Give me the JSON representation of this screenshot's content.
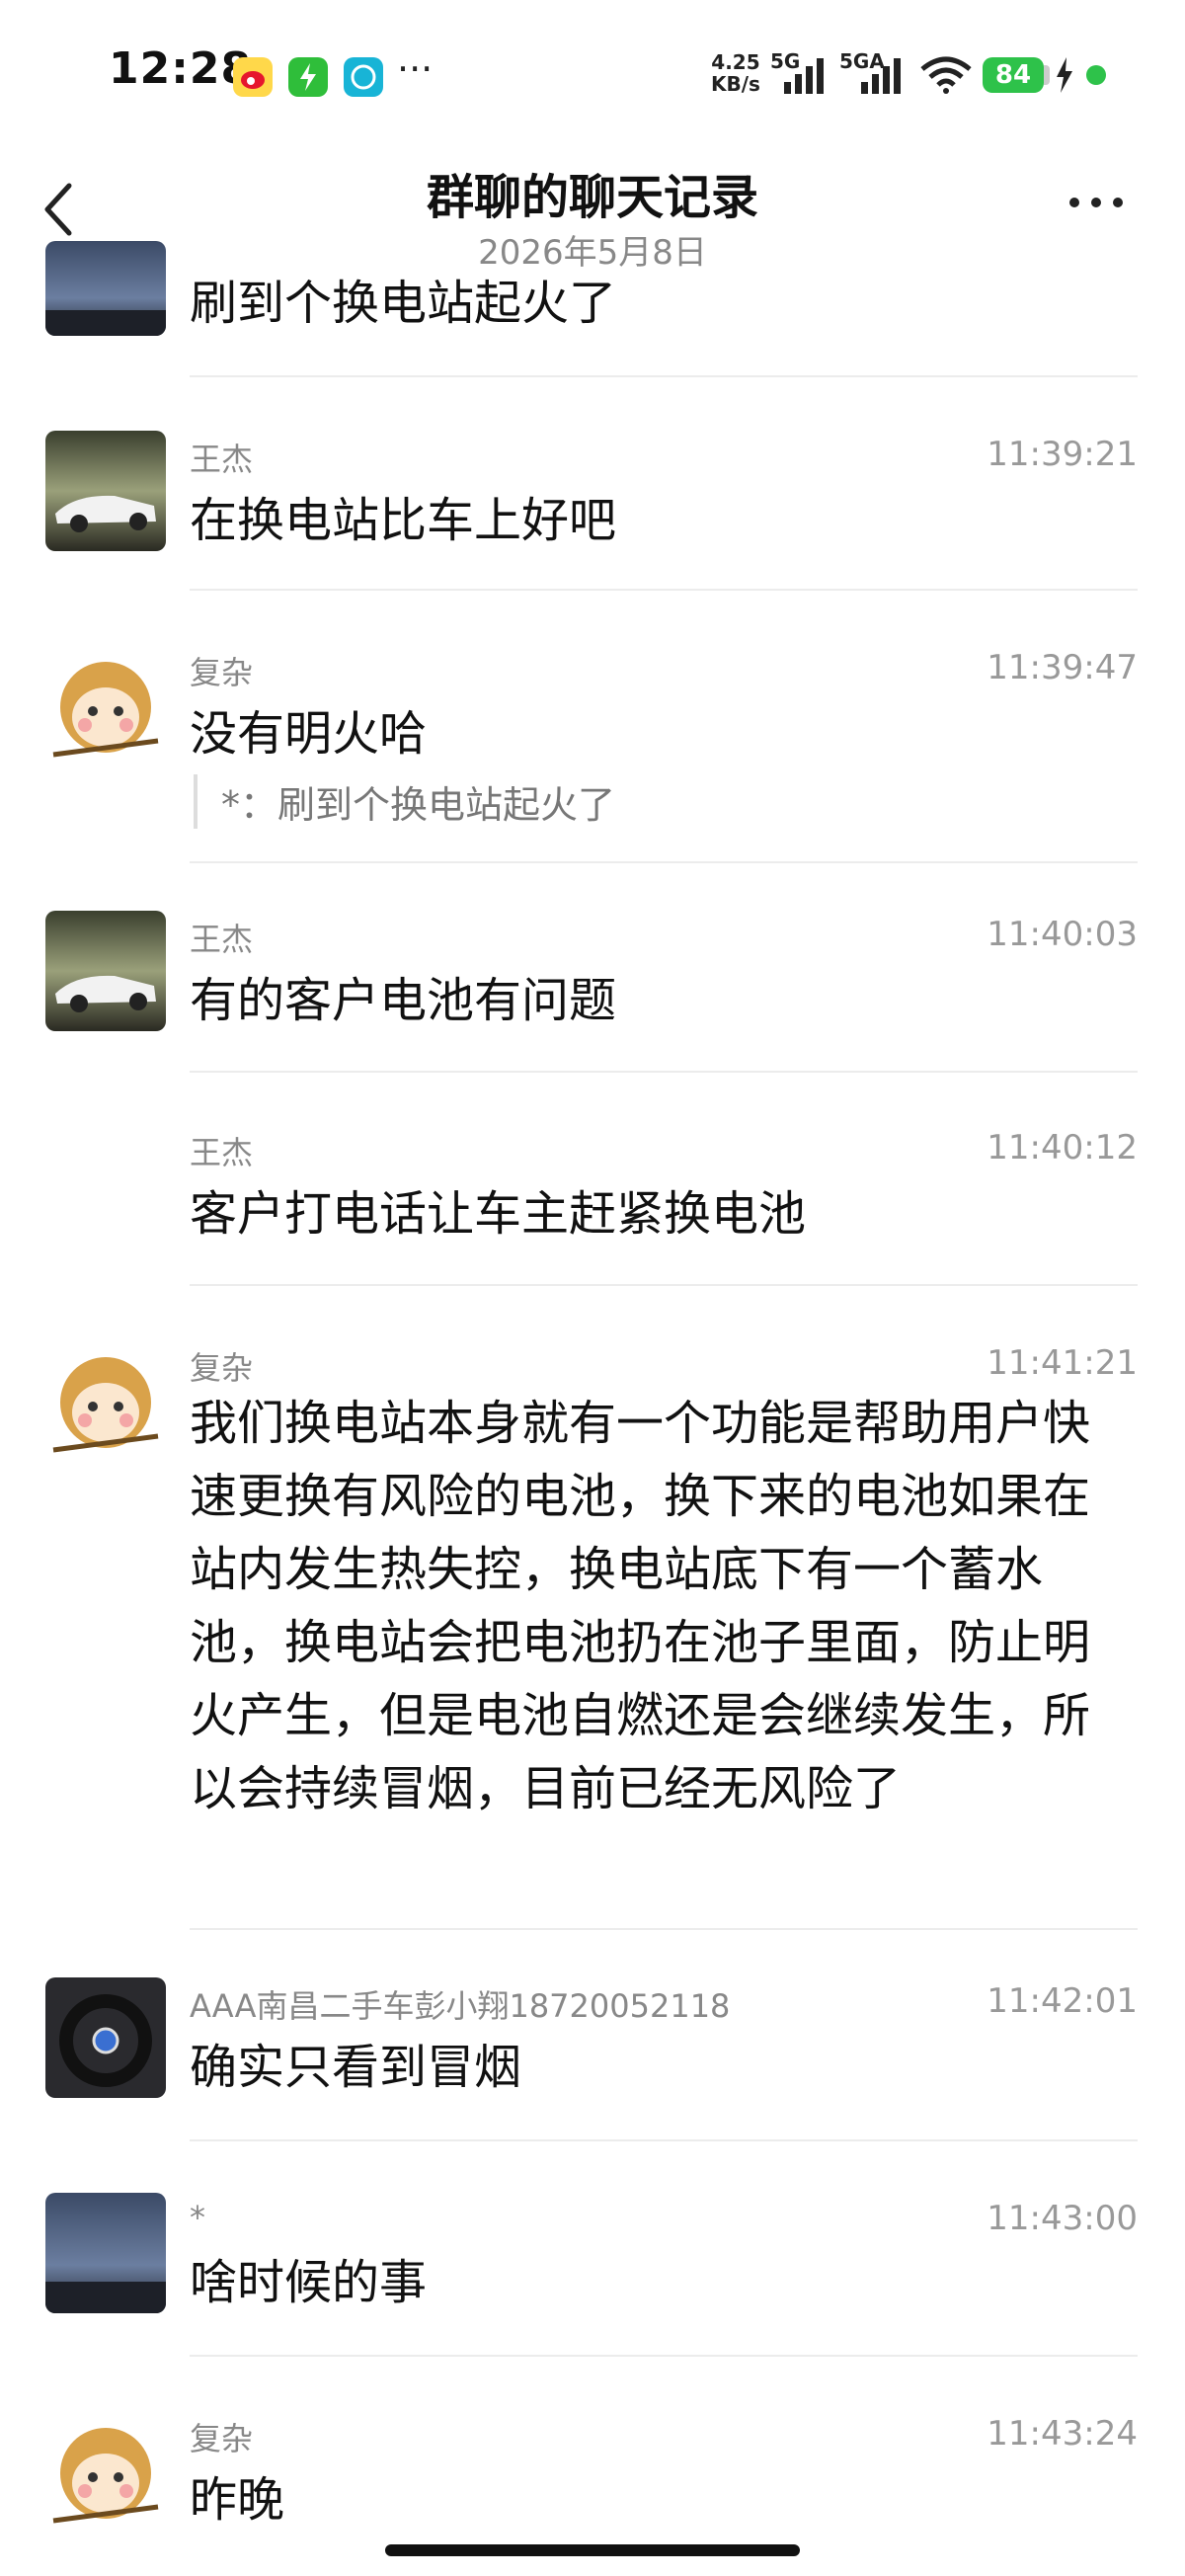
{
  "status_bar": {
    "time": "12:28",
    "net_speed_value": "4.25",
    "net_speed_unit": "KB/s",
    "sim1_label": "5G",
    "sim2_label": "5GA",
    "battery": "84",
    "icons": [
      "weibo-icon",
      "battery-saver-icon",
      "app-icon",
      "more-notifications-icon"
    ]
  },
  "header": {
    "title": "群聊的聊天记录",
    "subtitle": "2026年5月8日"
  },
  "messages": [
    {
      "sender": "",
      "time": "",
      "text": "刷到个换电站起火了",
      "avatar": "sunset-avatar"
    },
    {
      "sender": "王杰",
      "time": "11:39:21",
      "text": "在换电站比车上好吧",
      "avatar": "sports-car-avatar"
    },
    {
      "sender": "复杂",
      "time": "11:39:47",
      "text": "没有明火哈",
      "quote": "*：刷到个换电站起火了",
      "avatar": "monkey-avatar"
    },
    {
      "sender": "王杰",
      "time": "11:40:03",
      "text": "有的客户电池有问题",
      "avatar": "sports-car-avatar"
    },
    {
      "sender": "王杰",
      "time": "11:40:12",
      "text": "客户打电话让车主赶紧换电池",
      "avatar": ""
    },
    {
      "sender": "复杂",
      "time": "11:41:21",
      "text": "我们换电站本身就有一个功能是帮助用户快速更换有风险的电池，换下来的电池如果在站内发生热失控，换电站底下有一个蓄水池，换电站会把电池扔在池子里面，防止明火产生，但是电池自燃还是会继续发生，所以会持续冒烟，目前已经无风险了",
      "avatar": "monkey-avatar"
    },
    {
      "sender": "AAA南昌二手车彭小翔18720052118",
      "time": "11:42:01",
      "text": "确实只看到冒烟",
      "avatar": "steering-wheel-avatar"
    },
    {
      "sender": "*",
      "time": "11:43:00",
      "text": "啥时候的事",
      "avatar": "sunset-avatar"
    },
    {
      "sender": "复杂",
      "time": "11:43:24",
      "text": "昨晚",
      "avatar": "monkey-avatar"
    }
  ],
  "colors": {
    "battery_green": "#2ec24a",
    "muted_text": "#888888",
    "divider": "#ececec"
  }
}
